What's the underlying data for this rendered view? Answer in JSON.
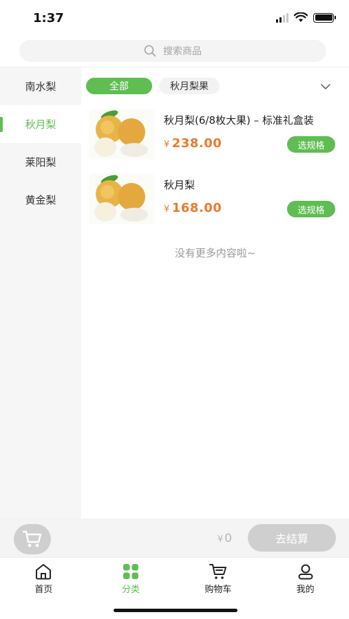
{
  "status_bar": {
    "time": "1:37"
  },
  "search": {
    "placeholder": "搜索商品"
  },
  "sidebar": {
    "items": [
      {
        "label": "南水梨",
        "active": false
      },
      {
        "label": "秋月梨",
        "active": true
      },
      {
        "label": "莱阳梨",
        "active": false
      },
      {
        "label": "黄金梨",
        "active": false
      }
    ]
  },
  "filters": {
    "chips": [
      "全部",
      "秋月梨果"
    ],
    "active_index": 0
  },
  "products": [
    {
      "name": "秋月梨(6/8枚大果) – 标准礼盒装",
      "currency": "¥",
      "price": "238.00",
      "button": "选规格"
    },
    {
      "name": "秋月梨",
      "currency": "¥",
      "price": "168.00",
      "button": "选规格"
    }
  ],
  "no_more_text": "没有更多内容啦~",
  "cart": {
    "currency": "¥",
    "total": "0",
    "checkout_label": "去结算"
  },
  "tabs": [
    {
      "label": "首页",
      "icon": "home-icon",
      "active": false
    },
    {
      "label": "分类",
      "icon": "category-icon",
      "active": true
    },
    {
      "label": "购物车",
      "icon": "cart-icon",
      "active": false
    },
    {
      "label": "我的",
      "icon": "user-icon",
      "active": false
    }
  ],
  "colors": {
    "accent": "#5fbd52",
    "price": "#ec7a2d",
    "disabled": "#cfcfcf"
  }
}
